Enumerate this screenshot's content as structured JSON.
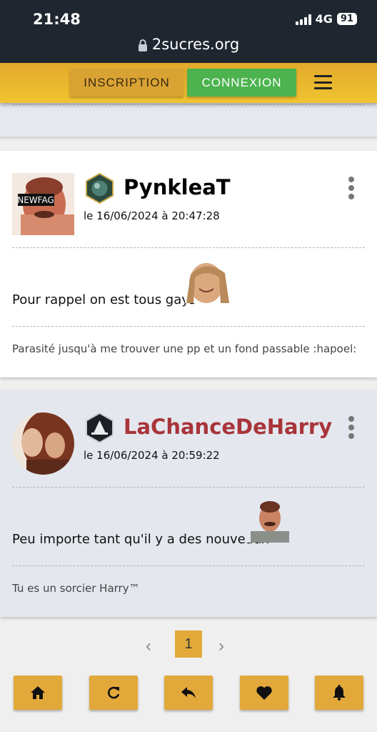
{
  "status_bar": {
    "time": "21:48",
    "network": "4G",
    "battery": "91"
  },
  "browser": {
    "url": "2sucres.org"
  },
  "nav": {
    "inscription_label": "INSCRIPTION",
    "connexion_label": "CONNEXION"
  },
  "messages": [
    {
      "author": "PynkleaT",
      "author_color": "#000000",
      "avatar_caption": "NEWFAG",
      "date": "le 16/06/2024 à 20:47:28",
      "text": "Pour rappel on est tous gays",
      "signature": "Parasité jusqu'à me trouver une pp et un fond passable :hapoel:"
    },
    {
      "author": "LaChanceDeHarry",
      "author_color": "#a8343a",
      "date": "le 16/06/2024 à 20:59:22",
      "text": "Peu importe tant qu'il y a des nouveaux",
      "signature": "Tu es un sorcier Harry™"
    }
  ],
  "pagination": {
    "current_page": "1",
    "prev": "‹",
    "next": "›"
  },
  "toolbar": {
    "icons": [
      "home-icon",
      "refresh-icon",
      "reply-icon",
      "heart-icon",
      "bell-icon"
    ]
  },
  "colors": {
    "accent": "#e2a93a",
    "connexion": "#4cb34f",
    "status_bar": "#1f2630"
  }
}
